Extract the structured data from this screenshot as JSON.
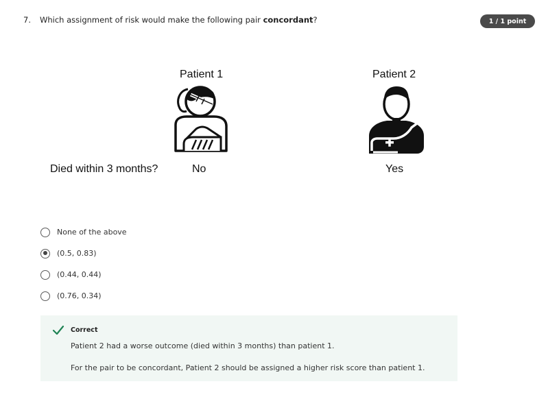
{
  "question": {
    "number": "7.",
    "text_before": "Which assignment of risk would make the following pair ",
    "text_bold": "concordant",
    "text_after": "?",
    "points": "1 / 1 point"
  },
  "figure": {
    "patient1_label": "Patient 1",
    "patient2_label": "Patient 2",
    "row_label": "Died within 3 months?",
    "patient1_value": "No",
    "patient2_value": "Yes",
    "patient1_icon": "injured-woman-arm-sling-icon",
    "patient2_icon": "injured-man-arm-sling-icon"
  },
  "options": [
    {
      "label": "None of the above",
      "selected": false
    },
    {
      "label": "(0.5, 0.83)",
      "selected": true
    },
    {
      "label": "(0.44, 0.44)",
      "selected": false
    },
    {
      "label": "(0.76, 0.34)",
      "selected": false
    }
  ],
  "feedback": {
    "status": "Correct",
    "line1": "Patient 2 had a worse outcome (died within 3 months) than patient 1.",
    "line2": "For the pair to be concordant, Patient 2 should be assigned a higher risk score than patient 1.",
    "accent_color": "#1f8354",
    "background": "#f1f7f4"
  }
}
